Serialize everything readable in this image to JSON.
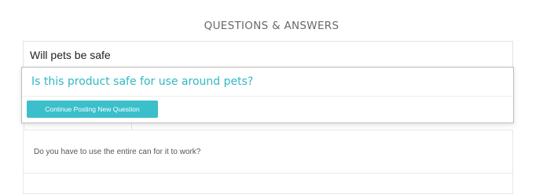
{
  "section": {
    "title": "QUESTIONS & ANSWERS"
  },
  "search": {
    "value": "Will pets be safe"
  },
  "suggestions": {
    "items": [
      {
        "label": "Is this product safe for use around pets?"
      }
    ],
    "continue_label": "Continue Posting New Question"
  },
  "questions": [
    {
      "text": "Do you have to use the entire can for it to work?"
    }
  ],
  "colors": {
    "accent": "#2fb8c6",
    "button_bg": "#3bbfcb",
    "heading_text": "#666a6c"
  }
}
